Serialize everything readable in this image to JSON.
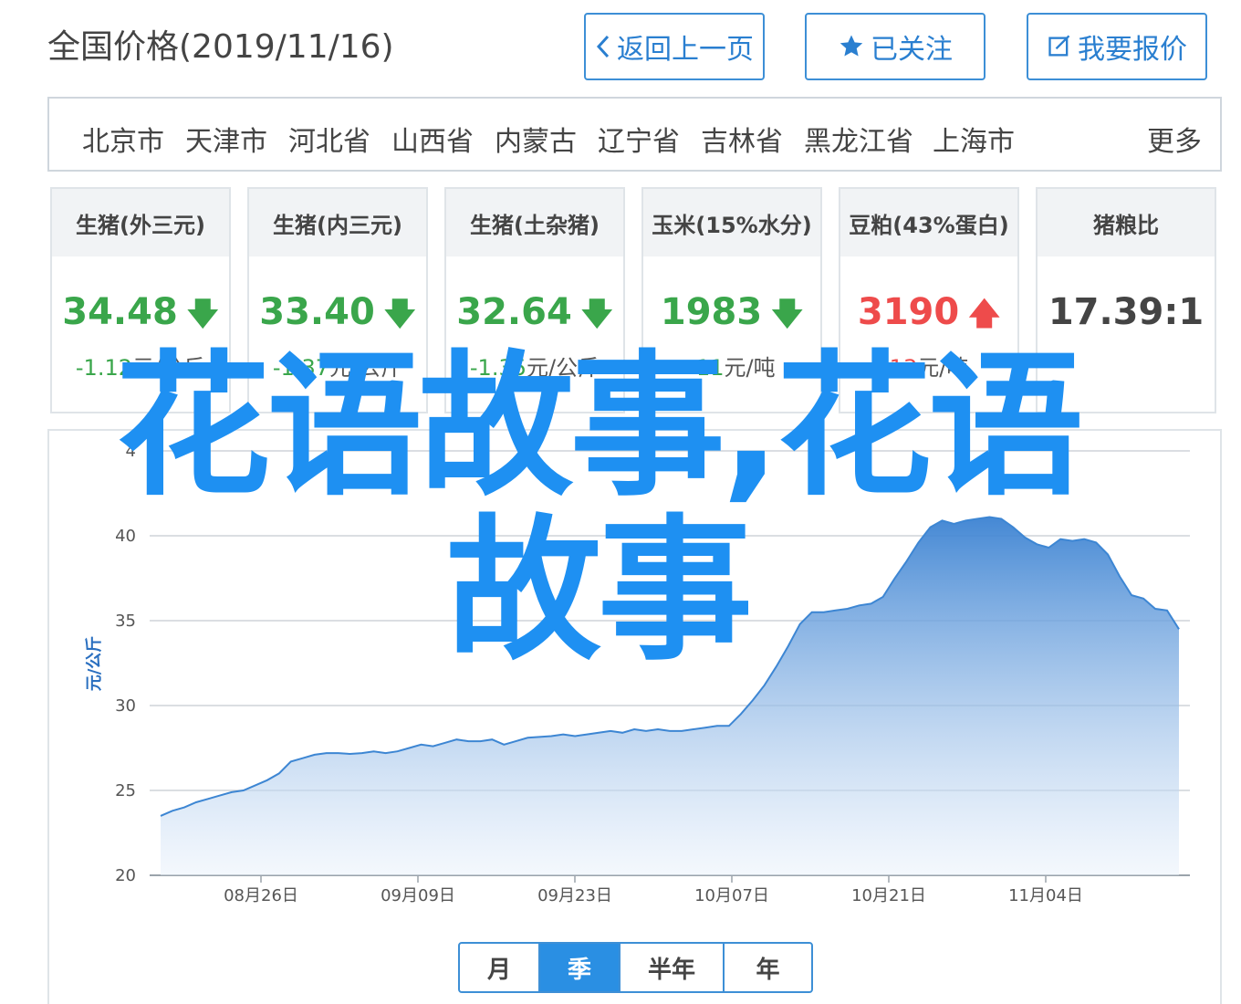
{
  "header": {
    "title": "全国价格(2019/11/16)",
    "back_label": "返回上一页",
    "follow_label": "已关注",
    "quote_label": "我要报价"
  },
  "regions": {
    "items": [
      "北京市",
      "天津市",
      "河北省",
      "山西省",
      "内蒙古",
      "辽宁省",
      "吉林省",
      "黑龙江省",
      "上海市"
    ],
    "more_label": "更多"
  },
  "cards": [
    {
      "name": "生猪(外三元)",
      "value": "34.48",
      "trend": "down",
      "change_num": "-1.12",
      "change_unit": "元/公斤"
    },
    {
      "name": "生猪(内三元)",
      "value": "33.40",
      "trend": "down",
      "change_num": "-1.37",
      "change_unit": "元/公斤"
    },
    {
      "name": "生猪(土杂猪)",
      "value": "32.64",
      "trend": "down",
      "change_num": "-1.35",
      "change_unit": "元/公斤"
    },
    {
      "name": "玉米(15%水分)",
      "value": "1983",
      "trend": "down",
      "change_num": "-11",
      "change_unit": "元/吨"
    },
    {
      "name": "豆粕(43%蛋白)",
      "value": "3190",
      "trend": "up",
      "change_num": "13",
      "change_unit": "元/吨"
    },
    {
      "name": "猪粮比",
      "value": "17.39:1",
      "trend": "none",
      "change_num": "",
      "change_unit": ""
    }
  ],
  "colors": {
    "accent": "#2a8fe3",
    "down": "#3aa64b",
    "up": "#ee4b4b",
    "line": "#3d86d3"
  },
  "chart_data": {
    "type": "area",
    "ylabel": "元/公斤",
    "ylim": [
      20,
      45
    ],
    "yticks": [
      20,
      25,
      30,
      35,
      40,
      45
    ],
    "yticks_labels": [
      "20",
      "25",
      "30",
      "35",
      "40",
      "4"
    ],
    "xticks": [
      "08月26日",
      "09月09日",
      "09月23日",
      "10月07日",
      "10月21日",
      "11月04日"
    ],
    "grid": true,
    "series": [
      {
        "values": [
          23.5,
          23.8,
          24.0,
          24.3,
          24.5,
          24.7,
          24.9,
          25.0,
          25.3,
          25.6,
          26.0,
          26.7,
          26.9,
          27.1,
          27.2,
          27.2,
          27.15,
          27.2,
          27.3,
          27.2,
          27.3,
          27.5,
          27.7,
          27.6,
          27.8,
          28.0,
          27.9,
          27.9,
          28.0,
          27.7,
          27.9,
          28.1,
          28.15,
          28.2,
          28.3,
          28.2,
          28.3,
          28.4,
          28.5,
          28.4,
          28.6,
          28.5,
          28.6,
          28.5,
          28.5,
          28.6,
          28.7,
          28.8,
          28.8,
          29.5,
          30.3,
          31.2,
          32.3,
          33.5,
          34.8,
          35.5,
          35.5,
          35.6,
          35.7,
          35.9,
          36.0,
          36.4,
          37.5,
          38.5,
          39.6,
          40.5,
          40.9,
          40.7,
          40.9,
          41.0,
          41.1,
          41.0,
          40.5,
          39.9,
          39.5,
          39.3,
          39.8,
          39.7,
          39.8,
          39.6,
          38.9,
          37.6,
          36.5,
          36.3,
          35.7,
          35.6,
          34.5
        ]
      }
    ]
  },
  "period_tabs": {
    "items": [
      "月",
      "季",
      "半年",
      "年"
    ],
    "active_index": 1
  },
  "watermark": {
    "line1": "花语故事,花语",
    "line2": "故事"
  }
}
